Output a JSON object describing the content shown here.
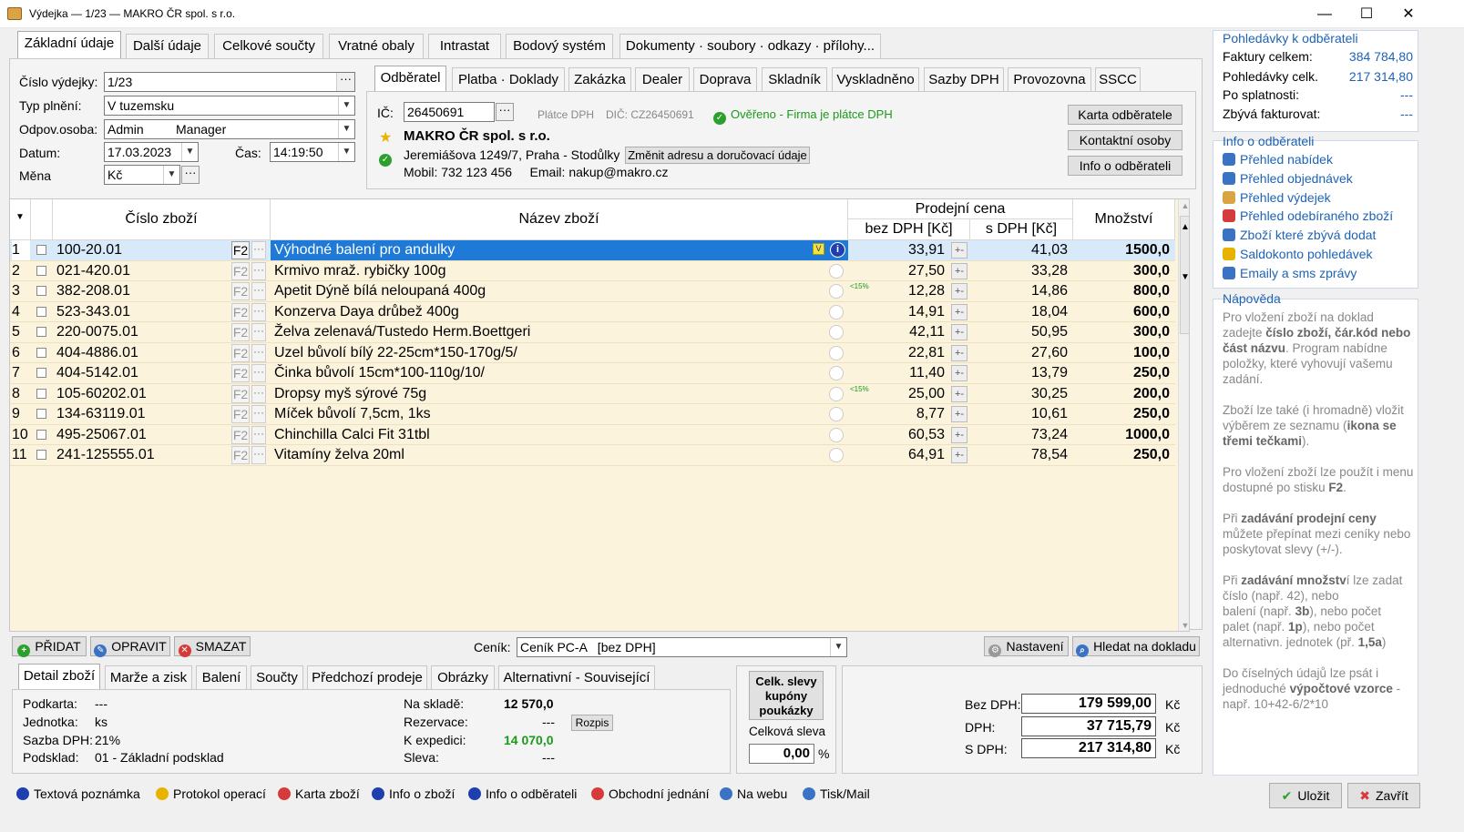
{
  "window": {
    "title": "Výdejka — 1/23 — MAKRO ČR spol. s r.o."
  },
  "main_tabs": [
    "Základní údaje",
    "Další údaje",
    "Celkové součty",
    "Vratné obaly",
    "Intrastat",
    "Bodový systém",
    "Dokumenty · soubory · odkazy · přílohy..."
  ],
  "form": {
    "cislo_label": "Číslo výdejky:",
    "cislo_value": "1/23",
    "typ_label": "Typ plnění:",
    "typ_value": "V tuzemsku",
    "osoba_label": "Odpov.osoba:",
    "osoba_value": "Admin",
    "osoba_value2": "Manager",
    "datum_label": "Datum:",
    "datum_value": "17.03.2023",
    "cas_label": "Čas:",
    "cas_value": "14:19:50",
    "mena_label": "Měna",
    "mena_value": "Kč"
  },
  "customer_tabs": [
    "Odběratel",
    "Platba · Doklady",
    "Zakázka",
    "Dealer",
    "Doprava",
    "Skladník",
    "Vyskladněno",
    "Sazby DPH",
    "Provozovna",
    "SSCC"
  ],
  "customer": {
    "ic_label": "IČ:",
    "ic_value": "26450691",
    "platce": "Plátce DPH",
    "dic": "DIČ: CZ26450691",
    "overeno": "Ověřeno - Firma je plátce DPH",
    "name": "MAKRO ČR spol. s r.o.",
    "address": "Jeremiášova 1249/7,  Praha - Stodůlky",
    "change_addr_btn": "Změnit adresu a doručovací údaje",
    "contact": "Mobil: 732 123 456     Email: nakup@makro.cz",
    "btn_karta": "Karta odběratele",
    "btn_kontakt": "Kontaktní osoby",
    "btn_info": "Info o odběrateli"
  },
  "grid": {
    "headers": {
      "cislo": "Číslo zboží",
      "nazev": "Název zboží",
      "prodejni": "Prodejní cena",
      "bez": "bez DPH [Kč]",
      "s": "s DPH [Kč]",
      "mnozstvi": "Množství"
    },
    "rows": [
      {
        "n": "1",
        "code": "100-20.01",
        "name": "Výhodné balení pro andulky",
        "bez": "33,91",
        "s": "41,03",
        "qty": "1500,0",
        "tag": ""
      },
      {
        "n": "2",
        "code": "021-420.01",
        "name": "Krmivo mraž. rybičky 100g",
        "bez": "27,50",
        "s": "33,28",
        "qty": "300,0",
        "tag": ""
      },
      {
        "n": "3",
        "code": "382-208.01",
        "name": "Apetit Dýně bílá neloupaná 400g",
        "bez": "12,28",
        "s": "14,86",
        "qty": "800,0",
        "tag": "<15%"
      },
      {
        "n": "4",
        "code": "523-343.01",
        "name": "Konzerva Daya drůbež 400g",
        "bez": "14,91",
        "s": "18,04",
        "qty": "600,0",
        "tag": ""
      },
      {
        "n": "5",
        "code": "220-0075.01",
        "name": "Želva zelenavá/Tustedo Herm.Boettgeri",
        "bez": "42,11",
        "s": "50,95",
        "qty": "300,0",
        "tag": ""
      },
      {
        "n": "6",
        "code": "404-4886.01",
        "name": "Uzel bůvolí bílý 22-25cm*150-170g/5/",
        "bez": "22,81",
        "s": "27,60",
        "qty": "100,0",
        "tag": ""
      },
      {
        "n": "7",
        "code": "404-5142.01",
        "name": "Činka bůvolí 15cm*100-110g/10/",
        "bez": "11,40",
        "s": "13,79",
        "qty": "250,0",
        "tag": ""
      },
      {
        "n": "8",
        "code": "105-60202.01",
        "name": "Dropsy myš sýrové 75g",
        "bez": "25,00",
        "s": "30,25",
        "qty": "200,0",
        "tag": "<15%"
      },
      {
        "n": "9",
        "code": "134-63119.01",
        "name": "Míček bůvolí 7,5cm, 1ks",
        "bez": "8,77",
        "s": "10,61",
        "qty": "250,0",
        "tag": ""
      },
      {
        "n": "10",
        "code": "495-25067.01",
        "name": "Chinchilla Calci Fit 31tbl",
        "bez": "60,53",
        "s": "73,24",
        "qty": "1000,0",
        "tag": ""
      },
      {
        "n": "11",
        "code": "241-125555.01",
        "name": "Vitamíny želva 20ml",
        "bez": "64,91",
        "s": "78,54",
        "qty": "250,0",
        "tag": ""
      }
    ]
  },
  "actions": {
    "pridat": "PŘIDAT",
    "opravit": "OPRAVIT",
    "smazat": "SMAZAT",
    "cenik_label": "Ceník:",
    "cenik_value": "Ceník PC-A   [bez DPH]",
    "nastaveni": "Nastavení",
    "hledat": "Hledat na dokladu"
  },
  "detail_tabs": [
    "Detail zboží",
    "Marže a zisk",
    "Balení",
    "Součty",
    "Předchozí prodeje",
    "Obrázky",
    "Alternativní - Související"
  ],
  "detail": {
    "podkarta_l": "Podkarta:",
    "podkarta_v": "---",
    "jednotka_l": "Jednotka:",
    "jednotka_v": "ks",
    "sazba_l": "Sazba DPH:",
    "sazba_v": "21%",
    "podsklad_l": "Podsklad:",
    "podsklad_v": "01 - Základní podsklad",
    "sklad_l": "Na skladě:",
    "sklad_v": "12 570,0",
    "rezervace_l": "Rezervace:",
    "rezervace_v": "---",
    "rozpis": "Rozpis",
    "expedici_l": "K expedici:",
    "expedici_v": "14 070,0",
    "sleva_l": "Sleva:",
    "sleva_v": "---"
  },
  "discount": {
    "btn": "Celk. slevy kupóny poukázky",
    "label": "Celková sleva",
    "value": "0,00",
    "unit": "%"
  },
  "totals": {
    "bez_l": "Bez DPH:",
    "bez_v": "179 599,00",
    "dph_l": "DPH:",
    "dph_v": "37 715,79",
    "s_l": "S DPH:",
    "s_v": "217 314,80",
    "cur": "Kč"
  },
  "side": {
    "pohl_head": "Pohledávky k odběrateli",
    "faktury_l": "Faktury celkem:",
    "faktury_v": "384 784,80",
    "pohl_l": "Pohledávky celk.",
    "pohl_v": "217 314,80",
    "splat_l": "Po splatnosti:",
    "splat_v": "---",
    "zbyva_l": "Zbývá fakturovat:",
    "zbyva_v": "---",
    "info_head": "Info o odběrateli",
    "links": [
      "Přehled nabídek",
      "Přehled objednávek",
      "Přehled výdejek",
      "Přehled odebíraného zboží",
      "Zboží které zbývá dodat",
      "Saldokonto pohledávek",
      "Emaily a sms zprávy"
    ],
    "help_head": "Nápověda"
  },
  "footer": {
    "links": [
      "Textová poznámka",
      "Protokol operací",
      "Karta zboží",
      "Info o zboží",
      "Info o odběrateli",
      "Obchodní jednání",
      "Na webu",
      "Tisk/Mail"
    ],
    "ulozit": "Uložit",
    "zavrit": "Zavřít"
  },
  "colors": {
    "accent": "#1e7ad6",
    "link": "#1e63b5",
    "green": "#1a9a1a",
    "grid_bg": "#fbf3dc"
  }
}
